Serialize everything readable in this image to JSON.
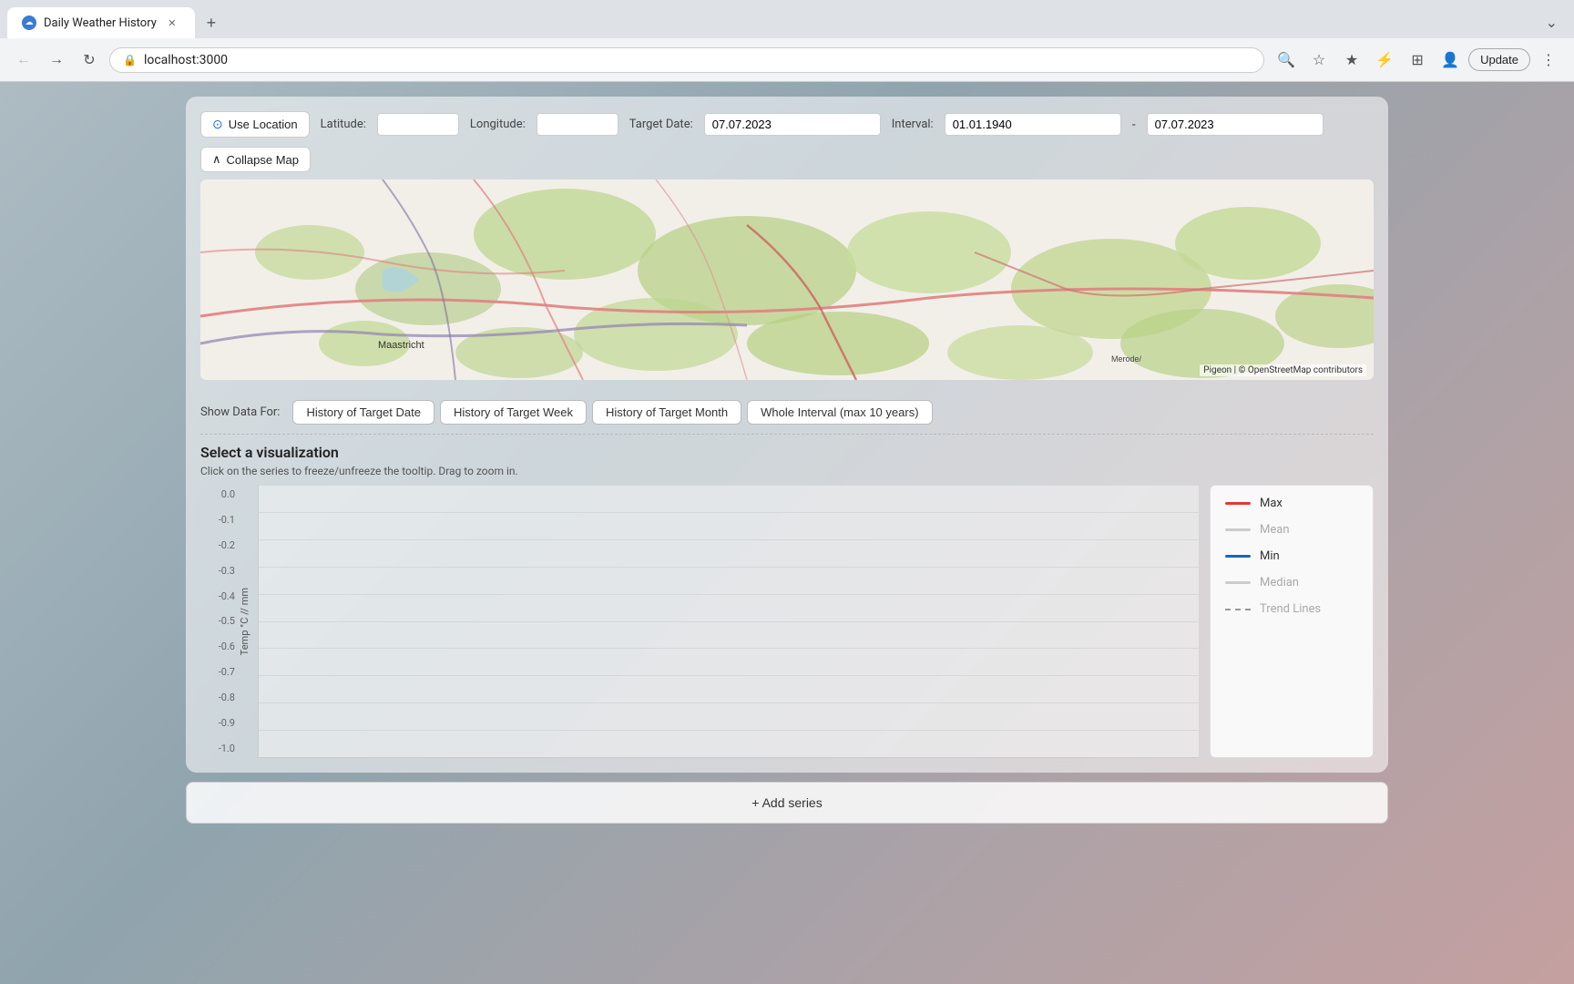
{
  "browser": {
    "tab_title": "Daily Weather History",
    "tab_favicon_text": "☁",
    "url": "localhost:3000",
    "update_btn_label": "Update"
  },
  "controls": {
    "use_location_label": "Use Location",
    "latitude_label": "Latitude:",
    "latitude_placeholder": "",
    "longitude_label": "Longitude:",
    "longitude_placeholder": "",
    "target_date_label": "Target Date:",
    "target_date_value": "07.07.2023",
    "interval_label": "Interval:",
    "interval_start": "01.01.1940",
    "interval_end": "07.07.2023",
    "collapse_map_label": "Collapse Map"
  },
  "show_data": {
    "label": "Show Data For:",
    "tabs": [
      "History of Target Date",
      "History of Target Week",
      "History of Target Month",
      "Whole Interval (max 10 years)"
    ]
  },
  "viz": {
    "title": "Select a visualization",
    "hint": "Click on the series to freeze/unfreeze the tooltip. Drag to zoom in.",
    "y_axis_label": "Temp °C // mm",
    "y_ticks": [
      "0.0",
      "-0.1",
      "-0.2",
      "-0.3",
      "-0.4",
      "-0.5",
      "-0.6",
      "-0.7",
      "-0.8",
      "-0.9",
      "-1.0"
    ]
  },
  "legend": {
    "items": [
      {
        "label": "Max",
        "color": "#e53935",
        "type": "solid",
        "active": true
      },
      {
        "label": "Mean",
        "color": "#999",
        "type": "solid",
        "active": false
      },
      {
        "label": "Min",
        "color": "#1565c0",
        "type": "solid",
        "active": true
      },
      {
        "label": "Median",
        "color": "#999",
        "type": "solid",
        "active": false
      },
      {
        "label": "Trend Lines",
        "color": "#999",
        "type": "dashed",
        "active": false
      }
    ]
  },
  "add_series": {
    "label": "+ Add series"
  },
  "map": {
    "attribution": "Pigeon | © OpenStreetMap contributors"
  }
}
